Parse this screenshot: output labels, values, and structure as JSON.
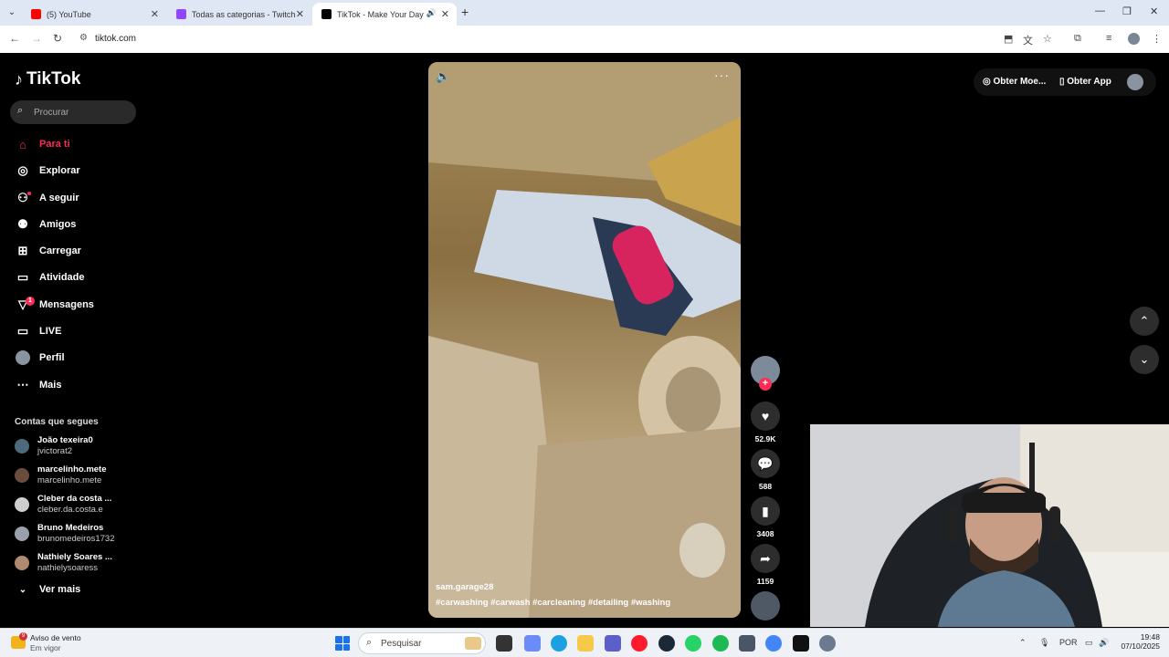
{
  "browser": {
    "tabs": [
      {
        "label": "(5) YouTube",
        "favicon_color": "#ff0000"
      },
      {
        "label": "Todas as categorias - Twitch",
        "favicon_color": "#9146ff"
      },
      {
        "label": "TikTok - Make Your Day",
        "favicon_color": "#000000",
        "active": true
      }
    ],
    "new_tab": "+",
    "url": "tiktok.com"
  },
  "tiktok": {
    "logo": "TikTok",
    "search_placeholder": "Procurar",
    "nav": [
      {
        "label": "Para ti",
        "icon": "home-icon",
        "active": true
      },
      {
        "label": "Explorar",
        "icon": "compass-icon"
      },
      {
        "label": "A seguir",
        "icon": "following-icon"
      },
      {
        "label": "Amigos",
        "icon": "friends-icon"
      },
      {
        "label": "Carregar",
        "icon": "upload-icon"
      },
      {
        "label": "Atividade",
        "icon": "activity-icon"
      },
      {
        "label": "Mensagens",
        "icon": "messages-icon",
        "badge": "1"
      },
      {
        "label": "LIVE",
        "icon": "live-icon"
      },
      {
        "label": "Perfil",
        "icon": "profile-avatar"
      },
      {
        "label": "Mais",
        "icon": "more-icon"
      }
    ],
    "following_title": "Contas que segues",
    "following": [
      {
        "name": "João texeira0",
        "handle": "jvictorat2"
      },
      {
        "name": "marcelinho.mete",
        "handle": "marcelinho.mete"
      },
      {
        "name": "Cleber da costa ...",
        "handle": "cleber.da.costa.e"
      },
      {
        "name": "Bruno Medeiros",
        "handle": "brunomedeiros1732"
      },
      {
        "name": "Nathiely Soares ...",
        "handle": "nathielysoaress"
      }
    ],
    "see_more": "Ver mais",
    "video": {
      "username": "sam.garage28",
      "hashtags": "#carwashing #carwash #carcleaning #detailing #washing"
    },
    "actions": {
      "likes": "52.9K",
      "comments": "588",
      "saves": "3408",
      "shares": "1159"
    },
    "header": {
      "coins": "Obter Moe...",
      "app": "Obter App"
    }
  },
  "taskbar": {
    "weather_title": "Aviso de vento",
    "weather_sub": "Em vigor",
    "weather_badge": "9",
    "search": "Pesquisar",
    "lang": "POR",
    "time": "19:48",
    "date": "07/10/2025"
  },
  "colors": {
    "accent": "#fe2c55",
    "tabbar": "#dfe7f5"
  }
}
